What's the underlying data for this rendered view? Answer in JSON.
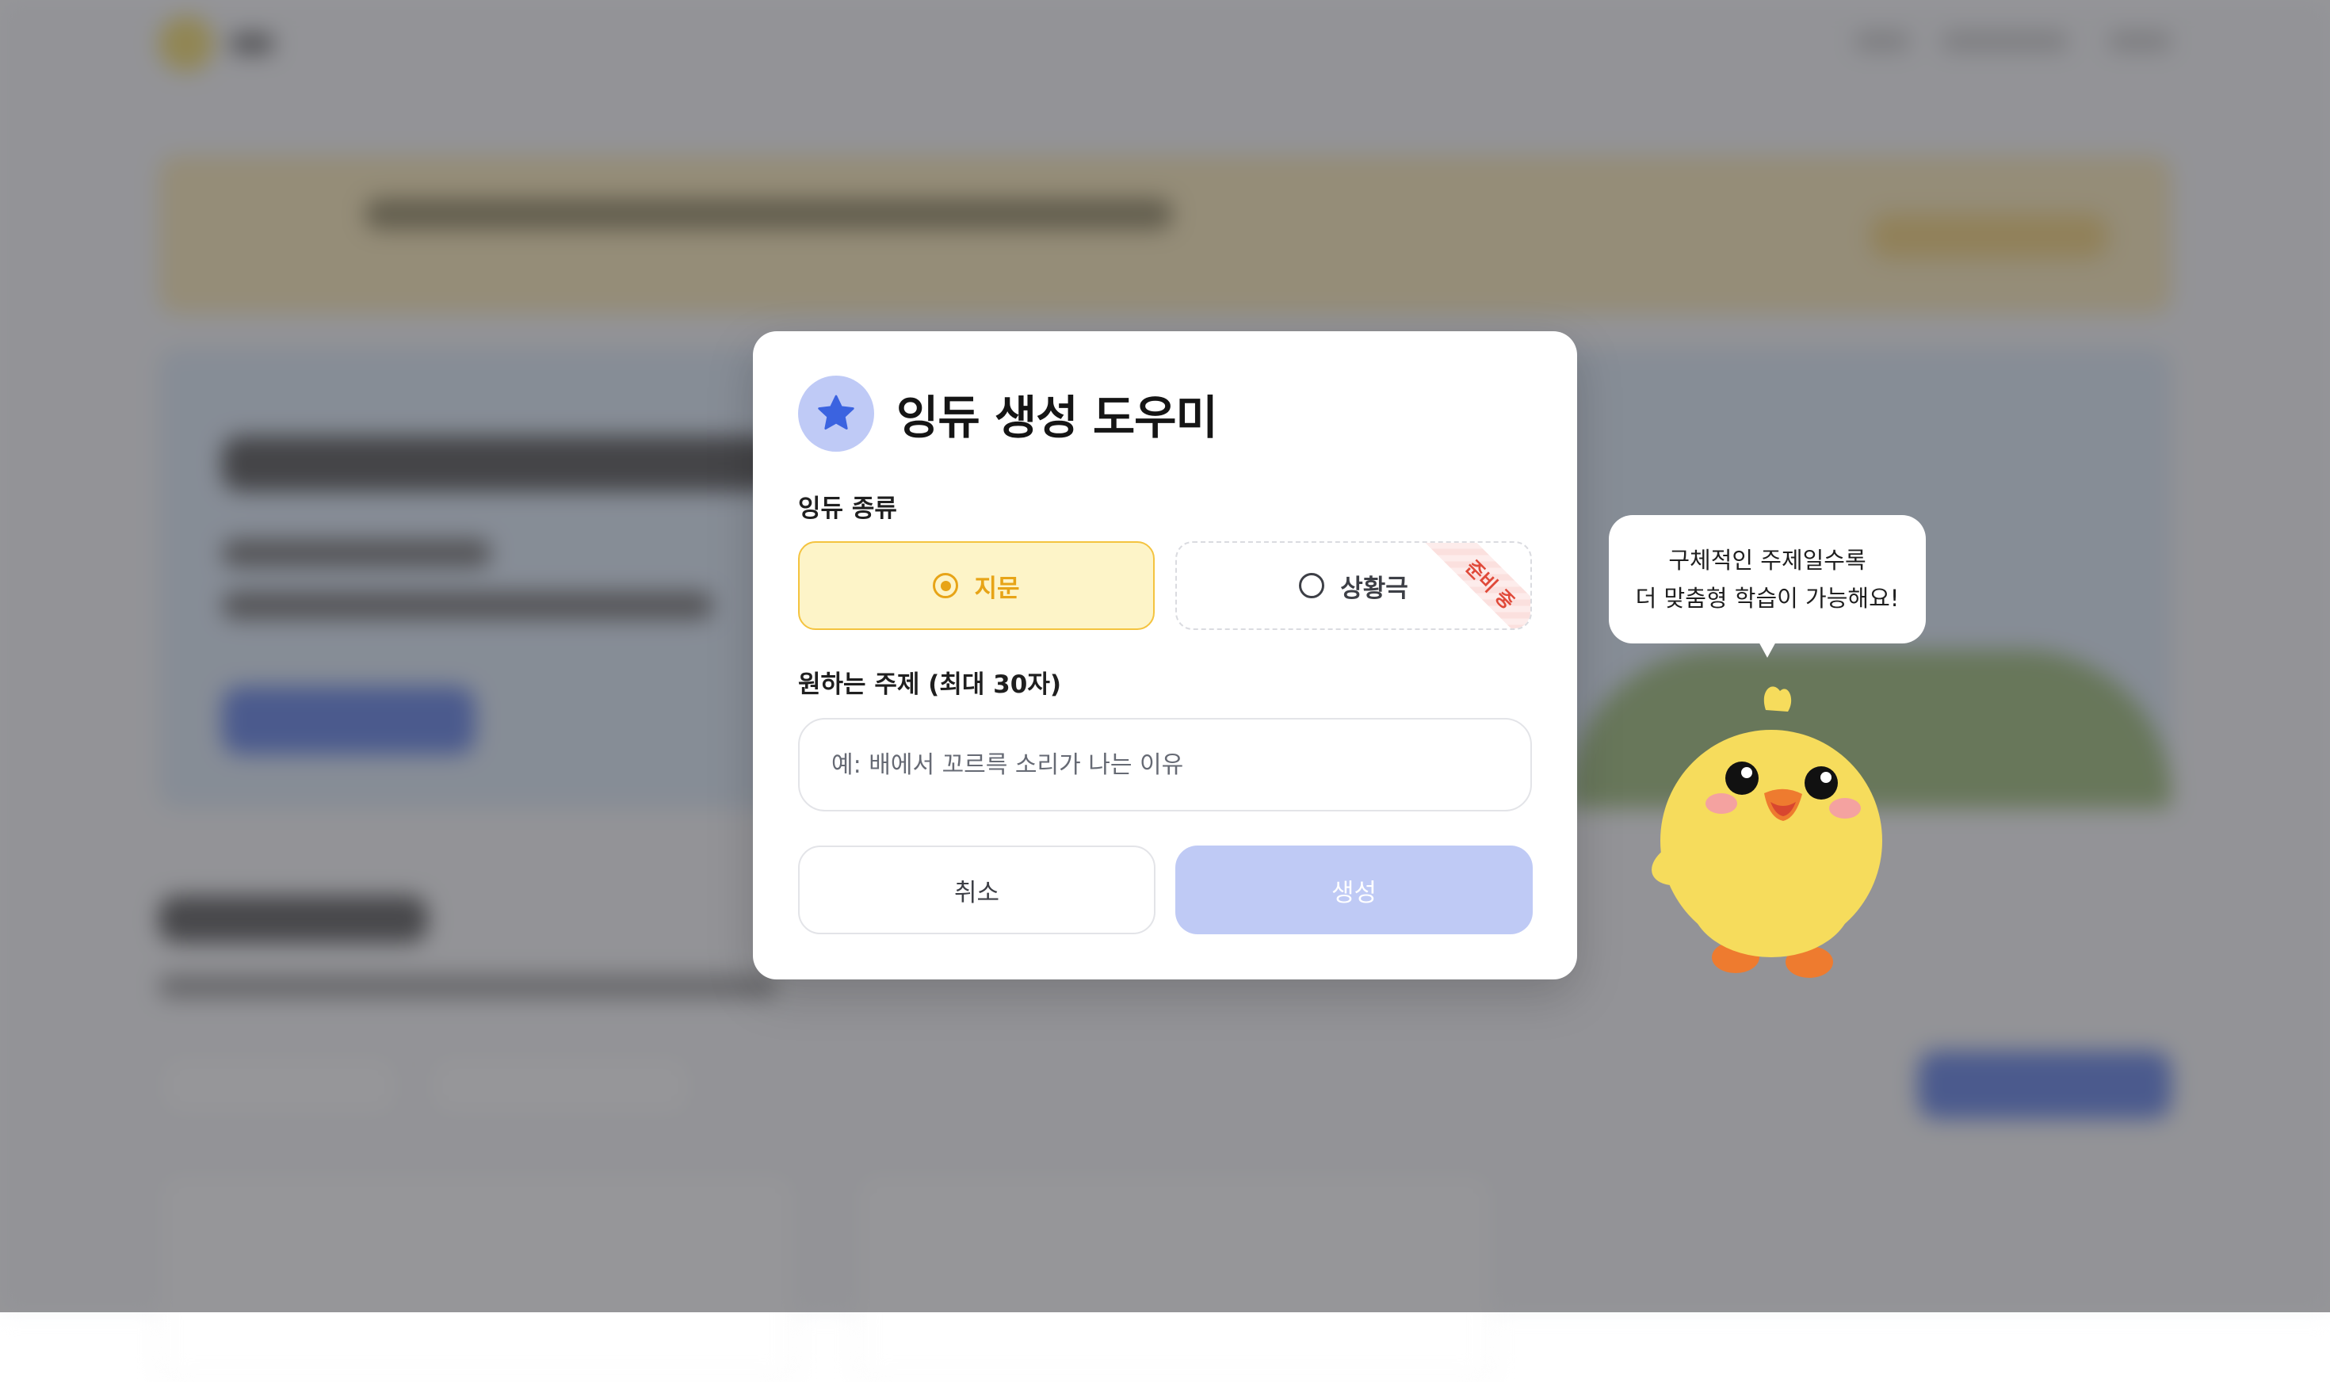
{
  "modal": {
    "title": "잉듀 생성 도우미",
    "type_label": "잉듀 종류",
    "options": [
      {
        "label": "지문",
        "selected": true
      },
      {
        "label": "상황극",
        "selected": false,
        "badge": "준비 중"
      }
    ],
    "topic_label": "원하는 주제 (최대 30자)",
    "topic_placeholder": "예: 배에서 꼬르륵 소리가 나는 이유",
    "topic_value": "",
    "cancel_label": "취소",
    "create_label": "생성",
    "create_enabled": false
  },
  "mascot": {
    "speech_line1": "구체적인 주제일수록",
    "speech_line2": "더 맞춤형 학습이 가능해요!"
  },
  "colors": {
    "accent_blue": "#3b63e0",
    "selected_yellow": "#f4c33f",
    "disabled_button": "#bfcaf5"
  }
}
